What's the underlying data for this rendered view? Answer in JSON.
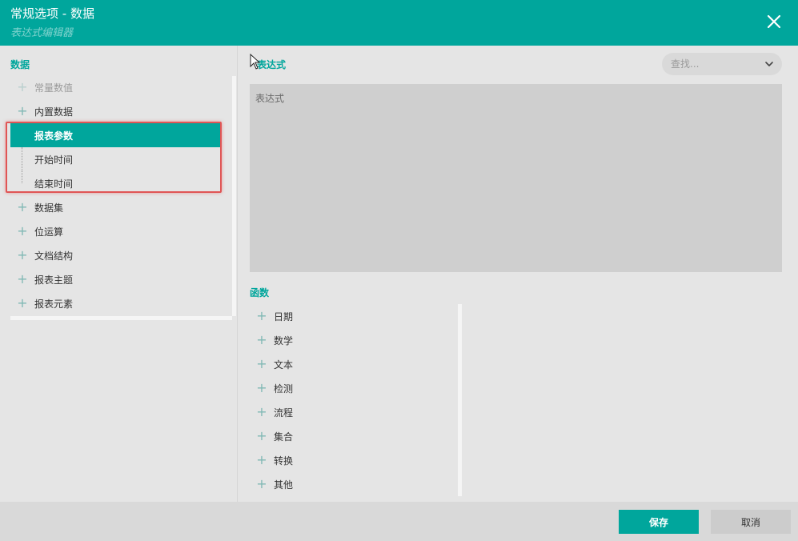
{
  "header": {
    "title": "常规选项 - 数据",
    "subtitle": "表达式编辑器"
  },
  "left_panel": {
    "section_label": "数据",
    "tree": [
      {
        "label": "常量数值",
        "expandable": true,
        "disabled": true
      },
      {
        "label": "内置数据",
        "expandable": true,
        "disabled": false
      },
      {
        "label": "报表参数",
        "child": true,
        "selected": true
      },
      {
        "label": "开始时间",
        "child": true,
        "selected": false
      },
      {
        "label": "结束时间",
        "child": true,
        "selected": false,
        "last": true
      },
      {
        "label": "数据集",
        "expandable": true
      },
      {
        "label": "位运算",
        "expandable": true
      },
      {
        "label": "文档结构",
        "expandable": true
      },
      {
        "label": "报表主题",
        "expandable": true
      },
      {
        "label": "报表元素",
        "expandable": true
      }
    ]
  },
  "expression": {
    "section_label": "表达式",
    "placeholder": "表达式",
    "value": ""
  },
  "search": {
    "placeholder": "查找..."
  },
  "functions": {
    "section_label": "函数",
    "items": [
      "日期",
      "数学",
      "文本",
      "检测",
      "流程",
      "集合",
      "转换",
      "其他"
    ]
  },
  "footer": {
    "save_label": "保存",
    "cancel_label": "取消"
  },
  "colors": {
    "accent": "#00a69c",
    "highlight_border": "#e05555"
  }
}
